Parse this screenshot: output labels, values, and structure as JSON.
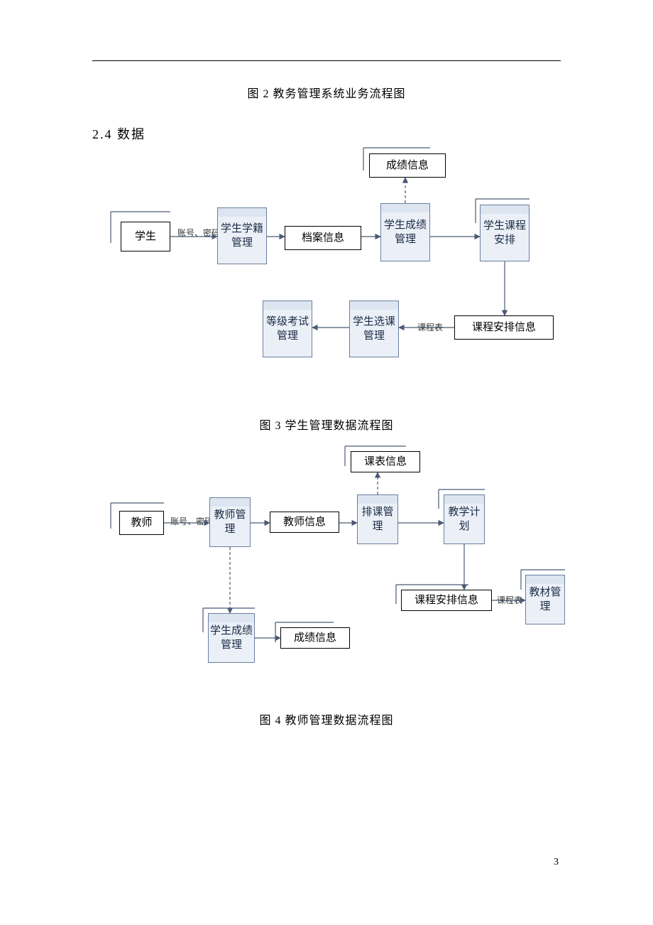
{
  "captions": {
    "fig2": "图 2 教务管理系统业务流程图",
    "fig3": "图 3 学生管理数据流程图",
    "fig4": "图 4 教师管理数据流程图"
  },
  "section": "2.4 数据",
  "page_number": "3",
  "diagram1": {
    "nodes": {
      "student": "学生",
      "cred_label": "账号、密码",
      "stu_status": "学生学籍管理",
      "profile_info": "档案信息",
      "stu_score_mgmt": "学生成绩管理",
      "score_info": "成绩信息",
      "stu_course_sched": "学生课程安排",
      "course_sched_info": "课程安排信息",
      "stu_select_mgmt": "学生选课管理",
      "rank_exam_mgmt": "等级考试管理",
      "sched_label": "课程表"
    }
  },
  "diagram2": {
    "nodes": {
      "teacher": "教师",
      "cred_label": "账号、密码",
      "teacher_mgmt": "教师管理",
      "teacher_info": "教师信息",
      "sched_mgmt": "排课管理",
      "sched_info": "课表信息",
      "teaching_plan": "教学计划",
      "course_sched_info": "课程安排信息",
      "textbook_mgmt": "教材管理",
      "sched_label": "课程表",
      "stu_score_mgmt": "学生成绩管理",
      "score_info": "成绩信息"
    }
  }
}
